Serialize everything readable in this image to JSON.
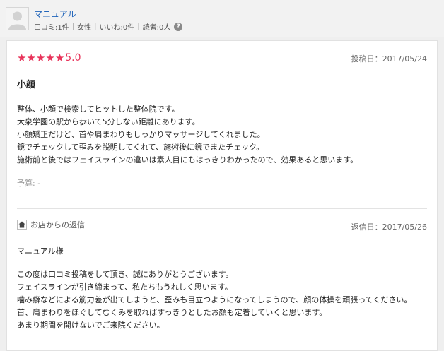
{
  "user": {
    "name": "マニュアル",
    "reviews": "口コミ:1件",
    "gender": "女性",
    "likes": "いいね:0件",
    "readers": "読者:0人",
    "help_icon": "question-icon"
  },
  "review": {
    "rating_stars": 5,
    "score": "5.0",
    "posted": "投稿日：2017/05/24",
    "title": "小顔",
    "lines": [
      "整体、小顔で検索してヒットした整体院です。",
      "大泉学園の駅から歩いて5分しない距離にあります。",
      "小顔矯正だけど、首や肩まわりもしっかりマッサージしてくれました。",
      "鏡でチェックして歪みを説明してくれて、施術後に鏡でまたチェック。",
      "施術前と後ではフェイスラインの違いは素人目にもはっきりわかったので、効果あると思います。"
    ],
    "budget": "予算: -"
  },
  "reply": {
    "title": "お店からの返信",
    "date": "返信日：2017/05/26",
    "greeting": "マニュアル様",
    "lines": [
      "この度は口コミ投稿をして頂き、誠にありがとうございます。",
      "フェイスラインが引き締まって、私たちもうれしく思います。",
      "噛み癖などによる筋力差が出てしまうと、歪みも目立つようになってしまうので、顔の体操を頑張ってください。",
      "首、肩まわりをほぐしてむくみを取ればすっきりとしたお顔も定着していくと思います。",
      "あまり期間を開けないでご来院ください。"
    ]
  },
  "colors": {
    "accent_star": "#e8335a",
    "link": "#2266bb"
  }
}
